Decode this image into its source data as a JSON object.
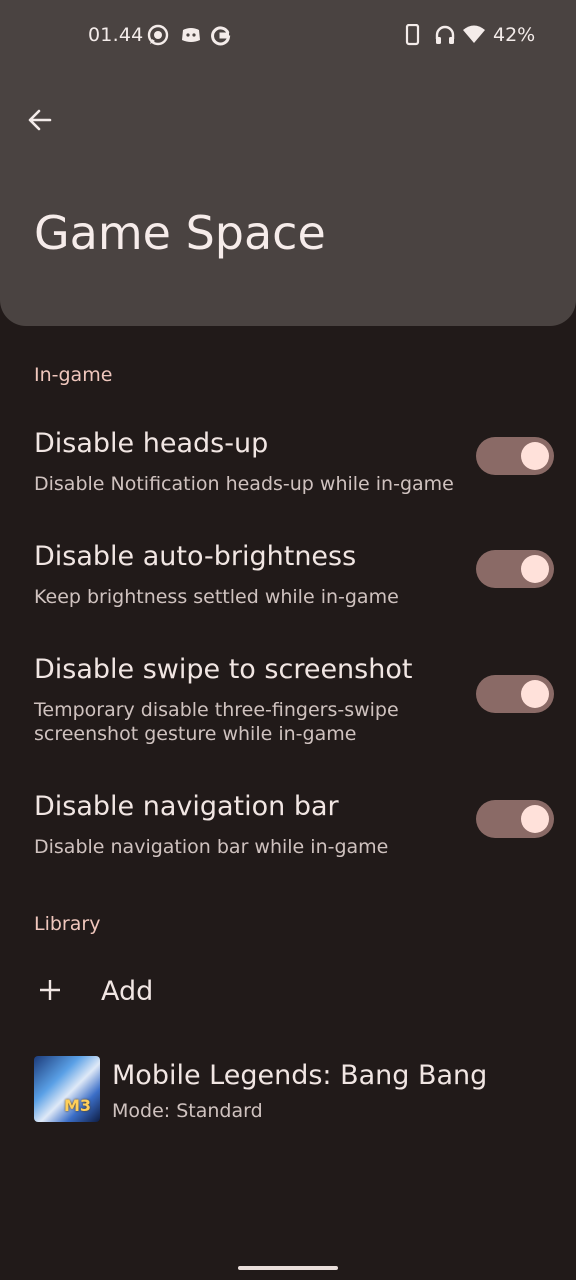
{
  "status_bar": {
    "time": "01.44",
    "battery": "42%",
    "left_icons": [
      "whatsapp-icon",
      "discord-icon",
      "google-icon"
    ],
    "right_icons": [
      "phone-icon",
      "headphones-icon",
      "wifi-icon"
    ]
  },
  "header": {
    "title": "Game Space"
  },
  "sections": {
    "ingame": {
      "label": "In-game",
      "items": [
        {
          "title": "Disable heads-up",
          "subtitle": "Disable Notification heads-up while in-game",
          "enabled": true
        },
        {
          "title": "Disable auto-brightness",
          "subtitle": "Keep brightness settled while in-game",
          "enabled": true
        },
        {
          "title": "Disable swipe to screenshot",
          "subtitle": "Temporary disable three-fingers-swipe screenshot gesture while in-game",
          "enabled": true
        },
        {
          "title": "Disable navigation bar",
          "subtitle": "Disable navigation bar while in-game",
          "enabled": true
        }
      ]
    },
    "library": {
      "label": "Library",
      "add_label": "Add",
      "games": [
        {
          "name": "Mobile Legends: Bang Bang",
          "mode": "Mode: Standard",
          "thumb_text": "M3"
        }
      ]
    }
  },
  "colors": {
    "background": "#211a19",
    "header": "#4a4341",
    "accent": "#f0c7bd",
    "toggle_track": "#8a6a66",
    "toggle_knob": "#ffe1da"
  }
}
